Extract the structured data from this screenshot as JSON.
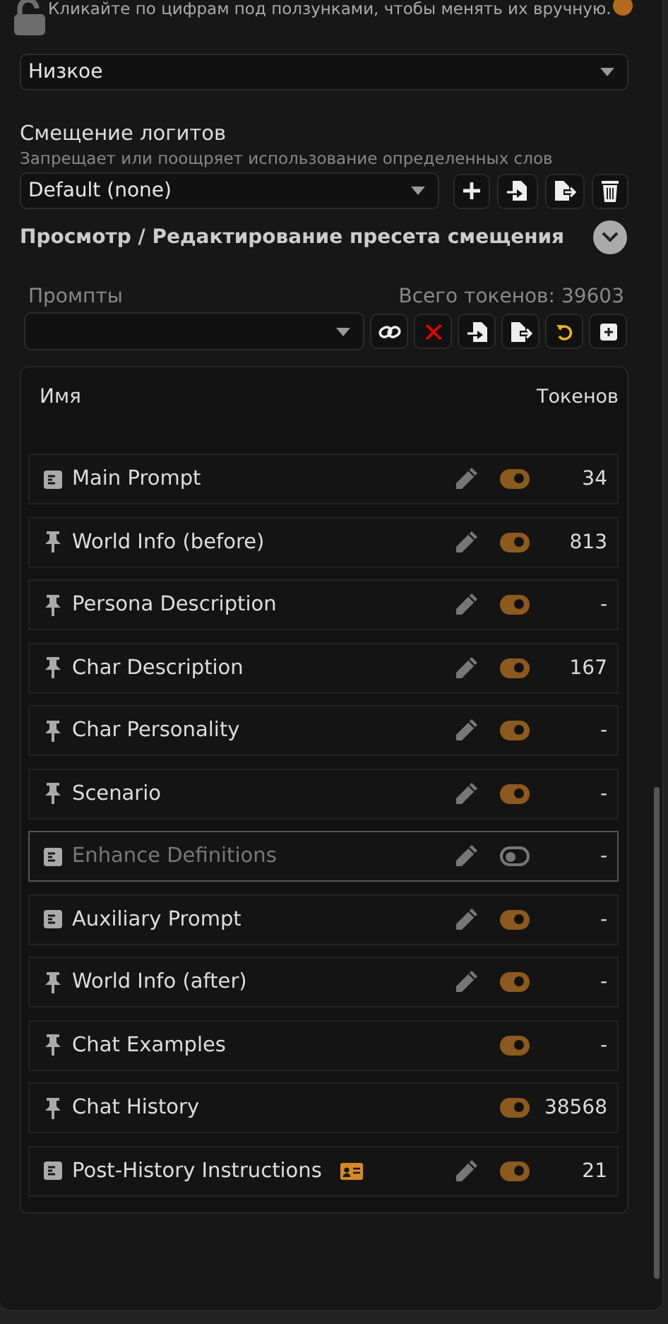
{
  "hint": "Кликайте по цифрам под ползунками, чтобы менять их вручную.",
  "image_quality": {
    "value": "Низкое"
  },
  "logit_bias": {
    "title": "Смещение логитов",
    "description": "Запрещает или поощряет использование определенных слов",
    "preset": "Default (none)"
  },
  "preset_editor": {
    "title": "Просмотр / Редактирование пресета смещения",
    "expanded": false
  },
  "prompts": {
    "label": "Промпты",
    "total_tokens": "Всего токенов: 39603"
  },
  "table": {
    "columns": [
      "Имя",
      "Токенов"
    ],
    "rows": [
      {
        "kind": "text",
        "name": "Main Prompt",
        "editable": true,
        "enabled": true,
        "tokens": "34",
        "override": false
      },
      {
        "kind": "marker",
        "name": "World Info (before)",
        "editable": true,
        "enabled": true,
        "tokens": "813",
        "override": false
      },
      {
        "kind": "marker",
        "name": "Persona Description",
        "editable": true,
        "enabled": true,
        "tokens": "-",
        "override": false
      },
      {
        "kind": "marker",
        "name": "Char Description",
        "editable": true,
        "enabled": true,
        "tokens": "167",
        "override": false
      },
      {
        "kind": "marker",
        "name": "Char Personality",
        "editable": true,
        "enabled": true,
        "tokens": "-",
        "override": false
      },
      {
        "kind": "marker",
        "name": "Scenario",
        "editable": true,
        "enabled": true,
        "tokens": "-",
        "override": false
      },
      {
        "kind": "text",
        "name": "Enhance Definitions",
        "editable": true,
        "enabled": false,
        "tokens": "-",
        "override": false
      },
      {
        "kind": "text",
        "name": "Auxiliary Prompt",
        "editable": true,
        "enabled": true,
        "tokens": "-",
        "override": false
      },
      {
        "kind": "marker",
        "name": "World Info (after)",
        "editable": true,
        "enabled": true,
        "tokens": "-",
        "override": false
      },
      {
        "kind": "marker",
        "name": "Chat Examples",
        "editable": false,
        "enabled": true,
        "tokens": "-",
        "override": false
      },
      {
        "kind": "marker",
        "name": "Chat History",
        "editable": false,
        "enabled": true,
        "tokens": "38568",
        "override": false
      },
      {
        "kind": "text",
        "name": "Post-History Instructions",
        "editable": true,
        "enabled": true,
        "tokens": "21",
        "override": true
      }
    ]
  }
}
